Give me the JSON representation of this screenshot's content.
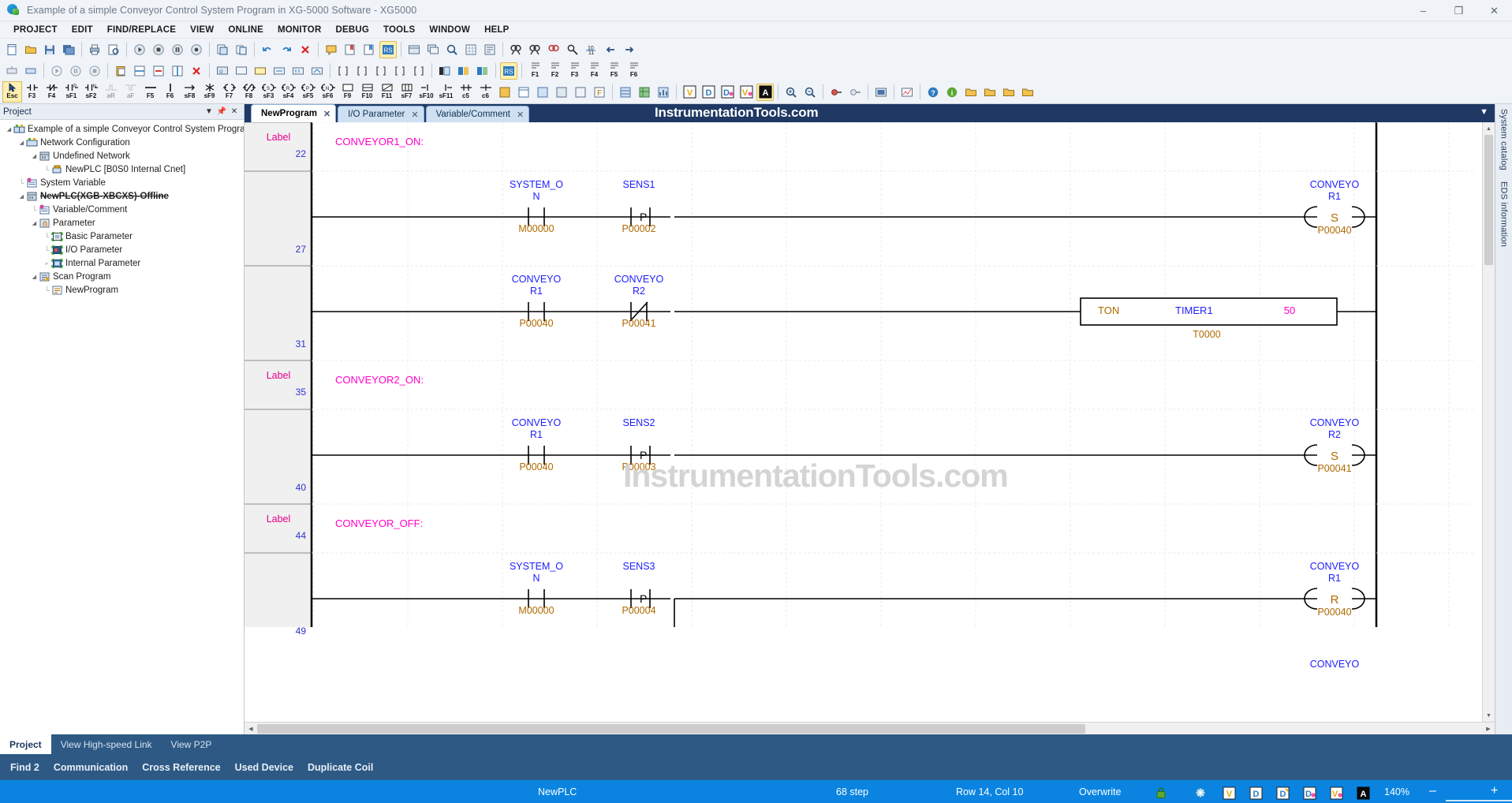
{
  "window": {
    "title": "Example of a simple Conveyor Control System Program in XG-5000 Software - XG5000",
    "minimize": "–",
    "maximize": "❐",
    "close": "✕"
  },
  "menubar": [
    "PROJECT",
    "EDIT",
    "FIND/REPLACE",
    "VIEW",
    "ONLINE",
    "MONITOR",
    "DEBUG",
    "TOOLS",
    "WINDOW",
    "HELP"
  ],
  "ladder_toolbar_keys": [
    "Esc",
    "F3",
    "F4",
    "sF1",
    "sF2",
    "aR",
    "aF",
    "F5",
    "F6",
    "sF8",
    "sF9",
    "F7",
    "F8",
    "sF3",
    "sF4",
    "sF5",
    "sF6",
    "F9",
    "F10",
    "F11",
    "sF7",
    "sF10",
    "sF11",
    "c5",
    "c6"
  ],
  "project_panel": {
    "title": "Project",
    "autohide_icon": "pin-icon",
    "close_icon": "close-icon",
    "tree": [
      {
        "label": "Example of a simple Conveyor Control System Progra...",
        "depth": 0,
        "icon": "project-icon",
        "expander": "◢"
      },
      {
        "label": "Network Configuration",
        "depth": 1,
        "icon": "network-icon",
        "expander": "◢"
      },
      {
        "label": "Undefined Network",
        "depth": 2,
        "icon": "plc-icon",
        "expander": "◢"
      },
      {
        "label": "NewPLC [B0S0 Internal Cnet]",
        "depth": 3,
        "icon": "cnet-icon",
        "expander": ""
      },
      {
        "label": "System Variable",
        "depth": 1,
        "icon": "variable-icon",
        "expander": ""
      },
      {
        "label": "NewPLC(XGB-XBCXS)-Offline",
        "depth": 1,
        "icon": "plc-icon",
        "expander": "◢",
        "bold_strike": true
      },
      {
        "label": "Variable/Comment",
        "depth": 2,
        "icon": "variable-icon",
        "expander": ""
      },
      {
        "label": "Parameter",
        "depth": 2,
        "icon": "parameter-icon",
        "expander": "◢"
      },
      {
        "label": "Basic Parameter",
        "depth": 3,
        "icon": "basic-param-icon",
        "expander": ""
      },
      {
        "label": "I/O Parameter",
        "depth": 3,
        "icon": "io-param-icon",
        "expander": ""
      },
      {
        "label": "Internal Parameter",
        "depth": 3,
        "icon": "internal-param-icon",
        "expander": "▹"
      },
      {
        "label": "Scan Program",
        "depth": 2,
        "icon": "scan-program-icon",
        "expander": "◢"
      },
      {
        "label": "NewProgram",
        "depth": 3,
        "icon": "program-icon",
        "expander": ""
      }
    ]
  },
  "document_tabs": [
    {
      "label": "NewProgram",
      "active": true,
      "close": "✕"
    },
    {
      "label": "I/O Parameter",
      "active": false,
      "close": "✕"
    },
    {
      "label": "Variable/Comment",
      "active": false,
      "close": "✕"
    }
  ],
  "tabstrip_watermark": "InstrumentationTools.com",
  "editor_watermark": "InstrumentationTools.com",
  "right_dock_tabs": [
    "System catalog",
    "EDS information"
  ],
  "ladder": {
    "rungs": [
      {
        "kind": "label",
        "row_label": "Label",
        "row_number": "22",
        "label_text": "CONVEYOR1_ON:"
      },
      {
        "kind": "rung",
        "row_number": "27",
        "elements": [
          {
            "type": "contact-no",
            "symbol_name": "SYSTEM_ON",
            "device": "M00000"
          },
          {
            "type": "contact-p",
            "symbol_name": "SENS1",
            "device": "P00002"
          }
        ],
        "output": {
          "type": "coil-set",
          "symbol_name": "CONVEYOR1",
          "device": "P00040",
          "glyph": "S"
        }
      },
      {
        "kind": "rung",
        "row_number": "31",
        "elements": [
          {
            "type": "contact-no",
            "symbol_name": "CONVEYOR1",
            "device": "P00040"
          },
          {
            "type": "contact-nc",
            "symbol_name": "CONVEYOR2",
            "device": "P00041"
          }
        ],
        "block": {
          "type": "function-block",
          "name": "TON",
          "operand1": "TIMER1",
          "operand2": "50",
          "instance": "T0000"
        }
      },
      {
        "kind": "label",
        "row_label": "Label",
        "row_number": "35",
        "label_text": "CONVEYOR2_ON:"
      },
      {
        "kind": "rung",
        "row_number": "40",
        "elements": [
          {
            "type": "contact-no",
            "symbol_name": "CONVEYOR1",
            "device": "P00040"
          },
          {
            "type": "contact-p",
            "symbol_name": "SENS2",
            "device": "P00003"
          }
        ],
        "output": {
          "type": "coil-set",
          "symbol_name": "CONVEYOR2",
          "device": "P00041",
          "glyph": "S"
        }
      },
      {
        "kind": "label",
        "row_label": "Label",
        "row_number": "44",
        "label_text": "CONVEYOR_OFF:"
      },
      {
        "kind": "rung",
        "row_number": "49",
        "elements": [
          {
            "type": "contact-no",
            "symbol_name": "SYSTEM_ON",
            "device": "M00000"
          },
          {
            "type": "contact-p",
            "symbol_name": "SENS3",
            "device": "P00004"
          }
        ],
        "output": {
          "type": "coil-reset",
          "symbol_name": "CONVEYOR1",
          "device": "P00040",
          "glyph": "R"
        }
      },
      {
        "kind": "partial",
        "output": {
          "type": "coil-reset",
          "symbol_name": "CONVEYOR"
        }
      }
    ],
    "symbol_names_split": {
      "SYSTEM_ON": [
        "SYSTEM_O",
        "N"
      ],
      "CONVEYOR1": [
        "CONVEYO",
        "R1"
      ],
      "CONVEYOR2": [
        "CONVEYO",
        "R2"
      ],
      "CONVEYOR": [
        "CONVEYO",
        ""
      ]
    }
  },
  "bottom_dock": {
    "tabs_upper": [
      {
        "label": "Project",
        "active": true
      },
      {
        "label": "View High-speed Link",
        "active": false
      },
      {
        "label": "View P2P",
        "active": false
      }
    ],
    "tabs_lower": [
      "Find 2",
      "Communication",
      "Cross Reference",
      "Used Device",
      "Duplicate Coil"
    ]
  },
  "statusbar": {
    "plc": "NewPLC",
    "steps": "68 step",
    "cursor": "Row 14, Col 10",
    "mode": "Overwrite",
    "zoom": "140%",
    "zoom_minus": "–",
    "zoom_plus": "+",
    "icons": [
      "lock-icon",
      "connection-icon",
      "view-variable-icon",
      "view-device-icon",
      "view-device-variable-icon",
      "view-device-comment-icon",
      "view-variable-comment-icon",
      "view-all-icon"
    ]
  },
  "colors": {
    "accent_blue": "#0a84e0",
    "dock_blue": "#2e5984",
    "tabstrip_blue": "#1f3864",
    "label_magenta": "#e6008c",
    "symbol_blue": "#2020ff",
    "device_orange": "#b06a00",
    "value_magenta": "#ff00c8"
  }
}
